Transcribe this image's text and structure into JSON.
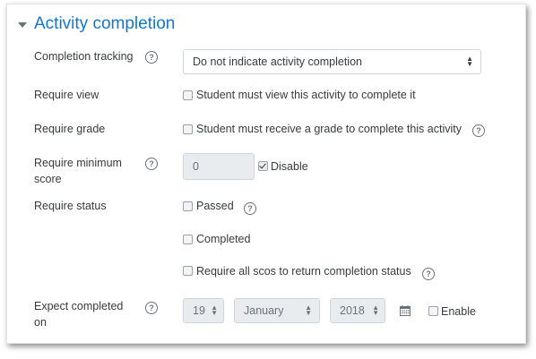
{
  "section": {
    "title": "Activity completion"
  },
  "completion_tracking": {
    "label": "Completion tracking",
    "help_glyph": "?",
    "selected": "Do not indicate activity completion"
  },
  "require_view": {
    "label": "Require view",
    "checkbox_label": "Student must view this activity to complete it"
  },
  "require_grade": {
    "label": "Require grade",
    "checkbox_label": "Student must receive a grade to complete this activity",
    "help_glyph": "?"
  },
  "require_min_score": {
    "label_line1": "Require minimum",
    "label_line2": "score",
    "help_glyph": "?",
    "value": "0",
    "disable_label": "Disable",
    "disable_checked": true
  },
  "require_status": {
    "label": "Require status",
    "passed_label": "Passed",
    "passed_help_glyph": "?",
    "completed_label": "Completed",
    "all_scos_label": "Require all scos to return completion status",
    "all_scos_help_glyph": "?"
  },
  "expect_completed": {
    "label_line1": "Expect completed",
    "label_line2": "on",
    "help_glyph": "?",
    "day": "19",
    "month": "January",
    "year": "2018",
    "enable_label": "Enable"
  },
  "icons": {
    "section_toggle": "caret-down-icon",
    "help": "question-circle-icon",
    "calendar": "calendar-icon"
  },
  "colors": {
    "accent": "#1177d1",
    "text": "#373a3c",
    "muted": "#6a737b"
  }
}
